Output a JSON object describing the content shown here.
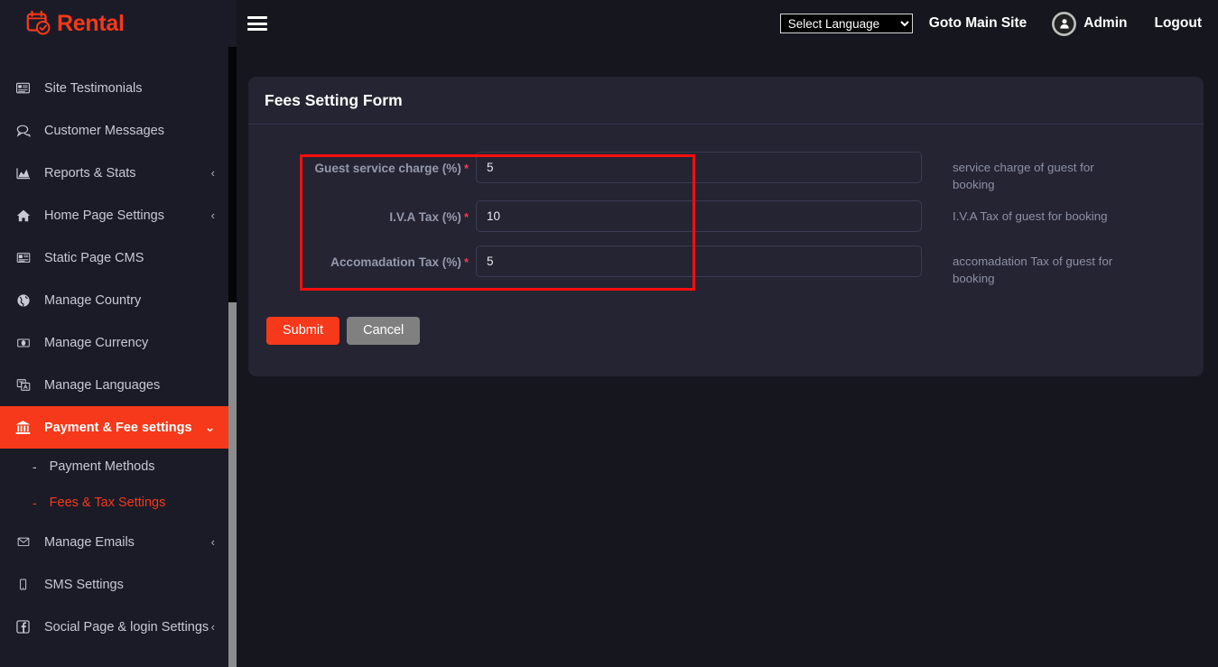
{
  "brand": {
    "name": "Rental",
    "icon": "calendar-check-icon",
    "color": "#f5391a"
  },
  "header": {
    "menu_toggle_icon": "hamburger-icon",
    "language_select": {
      "selected": "Select Language",
      "options": [
        "Select Language"
      ]
    },
    "main_site_link": "Goto Main Site",
    "avatar_icon": "user-avatar-icon",
    "admin_label": "Admin",
    "logout_label": "Logout"
  },
  "sidebar": {
    "items": [
      {
        "label": "Site Testimonials",
        "icon": "testimonial-card-icon",
        "chevron": "",
        "active": false
      },
      {
        "label": "Customer Messages",
        "icon": "chat-bubbles-icon",
        "chevron": "",
        "active": false
      },
      {
        "label": "Reports & Stats",
        "icon": "area-chart-icon",
        "chevron": "‹",
        "active": false
      },
      {
        "label": "Home Page Settings",
        "icon": "home-icon",
        "chevron": "‹",
        "active": false
      },
      {
        "label": "Static Page CMS",
        "icon": "newspaper-icon",
        "chevron": "",
        "active": false
      },
      {
        "label": "Manage Country",
        "icon": "globe-icon",
        "chevron": "",
        "active": false
      },
      {
        "label": "Manage Currency",
        "icon": "money-bill-icon",
        "chevron": "",
        "active": false
      },
      {
        "label": "Manage Languages",
        "icon": "language-icon",
        "chevron": "",
        "active": false
      },
      {
        "label": "Payment & Fee settings",
        "icon": "bank-icon",
        "chevron": "⌄",
        "active": true
      },
      {
        "label": "Manage Emails",
        "icon": "envelope-icon",
        "chevron": "‹",
        "active": false
      },
      {
        "label": "SMS Settings",
        "icon": "mobile-phone-icon",
        "chevron": "",
        "active": false
      },
      {
        "label": "Social Page & login Settings",
        "icon": "facebook-icon",
        "chevron": "‹",
        "active": false
      }
    ],
    "submenu": [
      {
        "label": "Payment Methods",
        "dash": "-",
        "active": false
      },
      {
        "label": "Fees & Tax Settings",
        "dash": "-",
        "active": true
      }
    ],
    "active_color": "#f5391a"
  },
  "card": {
    "title": "Fees Setting Form",
    "fields": [
      {
        "label": "Guest service charge (%)",
        "required": "*",
        "value": "5",
        "help": "service charge of guest for booking"
      },
      {
        "label": "I.V.A Tax (%)",
        "required": "*",
        "value": "10",
        "help": "I.V.A Tax of guest for booking"
      },
      {
        "label": "Accomadation Tax (%)",
        "required": "*",
        "value": "5",
        "help": "accomadation Tax of guest for booking"
      }
    ],
    "submit_label": "Submit",
    "cancel_label": "Cancel"
  },
  "annotation": {
    "color": "#fc0d0d"
  }
}
